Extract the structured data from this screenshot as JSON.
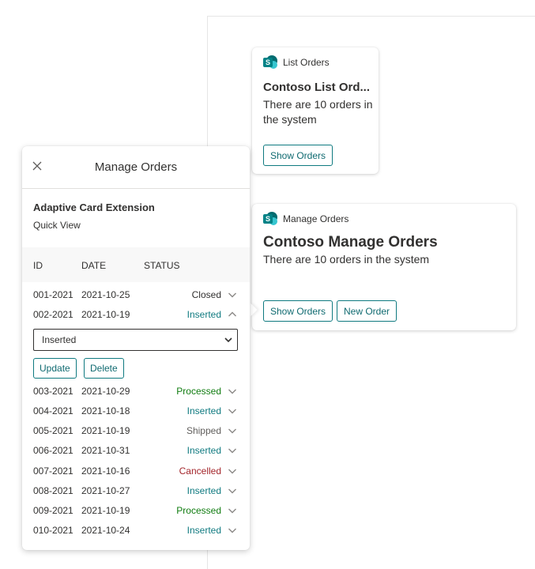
{
  "list_card": {
    "app_name": "List Orders",
    "heading": "Contoso List Ord...",
    "body": "There are 10 orders in the system",
    "button": "Show Orders",
    "icon": "sharepoint-icon",
    "icon_letter": "S"
  },
  "manage_card": {
    "app_name": "Manage Orders",
    "heading": "Contoso Manage Orders",
    "body": "There are 10 orders in the system",
    "buttons": {
      "show": "Show Orders",
      "new": "New Order"
    },
    "icon": "sharepoint-icon",
    "icon_letter": "S"
  },
  "quick_view": {
    "title": "Manage Orders",
    "extension_title": "Adaptive Card Extension",
    "extension_subtitle": "Quick View",
    "columns": {
      "id": "ID",
      "date": "DATE",
      "status": "STATUS"
    },
    "orders": [
      {
        "id": "001-2021",
        "date": "2021-10-25",
        "status": "Closed"
      },
      {
        "id": "002-2021",
        "date": "2021-10-19",
        "status": "Inserted",
        "expanded": true
      },
      {
        "id": "003-2021",
        "date": "2021-10-29",
        "status": "Processed"
      },
      {
        "id": "004-2021",
        "date": "2021-10-18",
        "status": "Inserted"
      },
      {
        "id": "005-2021",
        "date": "2021-10-19",
        "status": "Shipped"
      },
      {
        "id": "006-2021",
        "date": "2021-10-31",
        "status": "Inserted"
      },
      {
        "id": "007-2021",
        "date": "2021-10-16",
        "status": "Cancelled"
      },
      {
        "id": "008-2021",
        "date": "2021-10-27",
        "status": "Inserted"
      },
      {
        "id": "009-2021",
        "date": "2021-10-19",
        "status": "Processed"
      },
      {
        "id": "010-2021",
        "date": "2021-10-24",
        "status": "Inserted"
      }
    ],
    "expanded_editor": {
      "selected_status": "Inserted",
      "update_label": "Update",
      "delete_label": "Delete"
    }
  },
  "colors": {
    "accent": "#0f7a80",
    "processed": "#107c10",
    "cancelled": "#a4262c",
    "shipped": "#605e5c"
  }
}
